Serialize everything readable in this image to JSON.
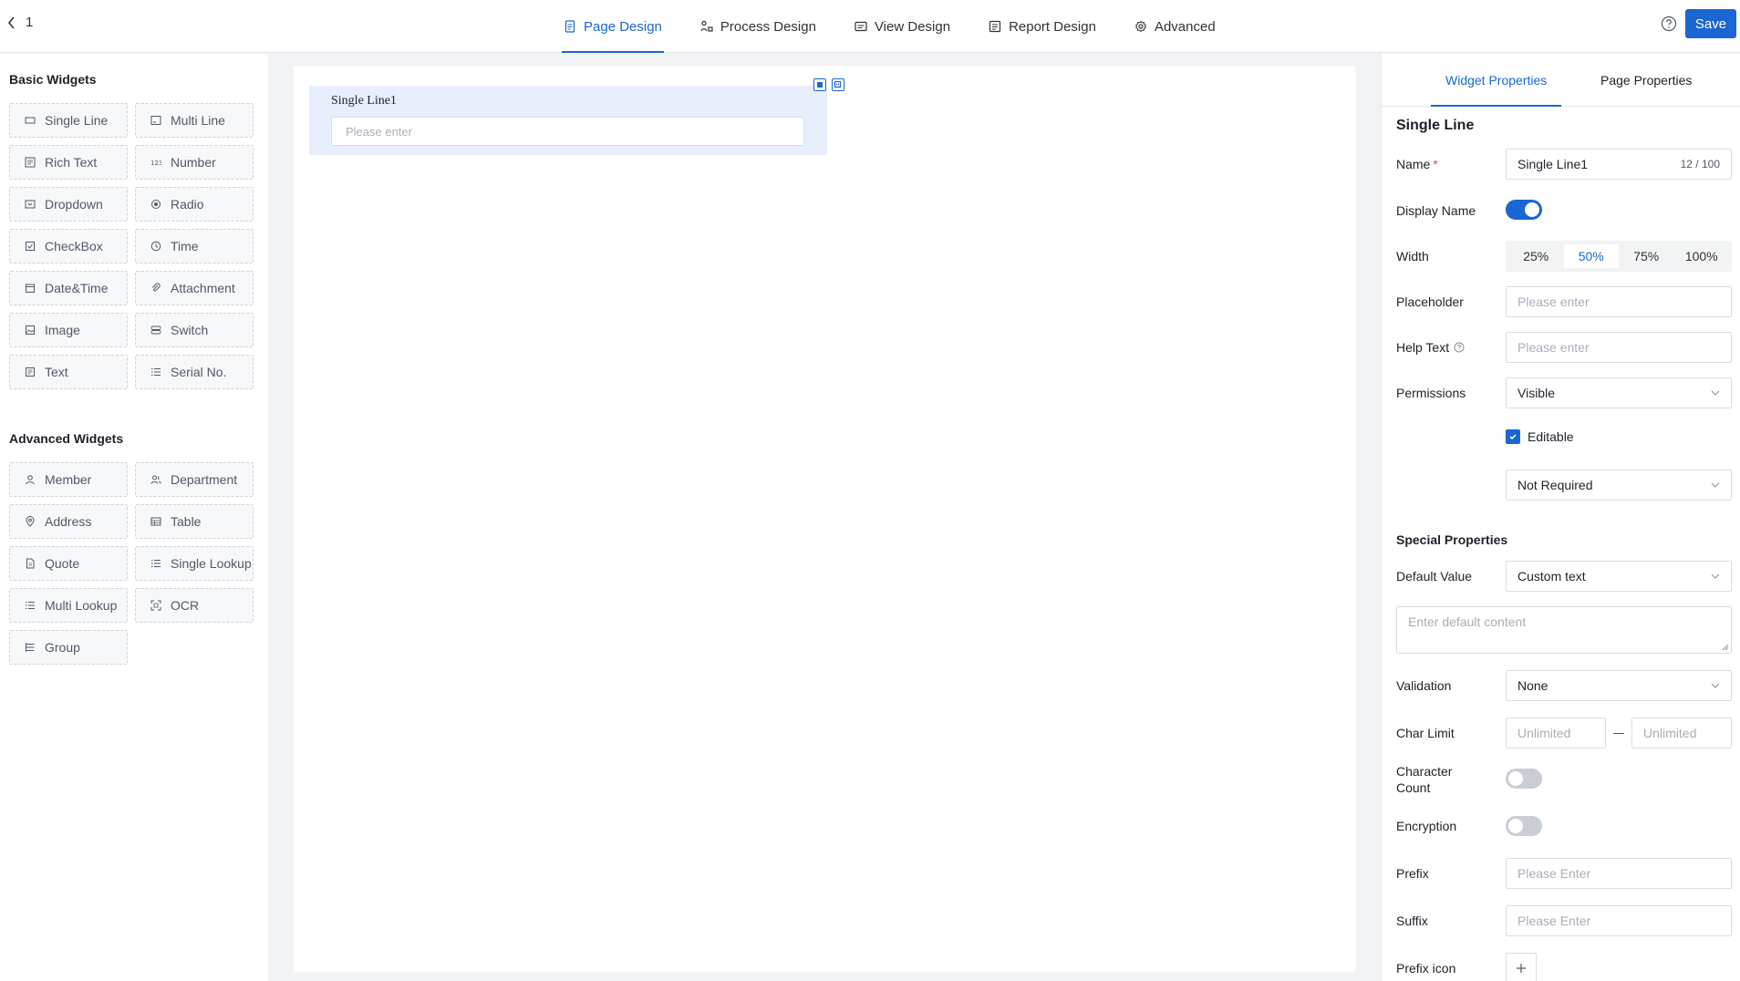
{
  "header": {
    "back_label": "1",
    "tabs": [
      {
        "label": "Page Design",
        "icon": "document-icon",
        "active": true
      },
      {
        "label": "Process Design",
        "icon": "flow-icon",
        "active": false
      },
      {
        "label": "View Design",
        "icon": "view-icon",
        "active": false
      },
      {
        "label": "Report Design",
        "icon": "report-icon",
        "active": false
      },
      {
        "label": "Advanced",
        "icon": "gear-icon",
        "active": false
      }
    ],
    "save_label": "Save"
  },
  "left_panel": {
    "basic_title": "Basic Widgets",
    "basic_widgets": [
      {
        "label": "Single Line",
        "icon": "single-line-icon"
      },
      {
        "label": "Multi Line",
        "icon": "multi-line-icon"
      },
      {
        "label": "Rich Text",
        "icon": "rich-text-icon"
      },
      {
        "label": "Number",
        "icon": "number-icon"
      },
      {
        "label": "Dropdown",
        "icon": "dropdown-icon"
      },
      {
        "label": "Radio",
        "icon": "radio-icon"
      },
      {
        "label": "CheckBox",
        "icon": "checkbox-icon"
      },
      {
        "label": "Time",
        "icon": "clock-icon"
      },
      {
        "label": "Date&Time",
        "icon": "calendar-icon"
      },
      {
        "label": "Attachment",
        "icon": "paperclip-icon"
      },
      {
        "label": "Image",
        "icon": "image-icon"
      },
      {
        "label": "Switch",
        "icon": "switch-icon"
      },
      {
        "label": "Text",
        "icon": "text-icon"
      },
      {
        "label": "Serial No.",
        "icon": "list-icon"
      }
    ],
    "advanced_title": "Advanced Widgets",
    "advanced_widgets": [
      {
        "label": "Member",
        "icon": "user-icon"
      },
      {
        "label": "Department",
        "icon": "department-icon"
      },
      {
        "label": "Address",
        "icon": "location-pin-icon"
      },
      {
        "label": "Table",
        "icon": "table-icon"
      },
      {
        "label": "Quote",
        "icon": "quote-icon"
      },
      {
        "label": "Single Lookup",
        "icon": "lookup-icon"
      },
      {
        "label": "Multi Lookup",
        "icon": "multi-lookup-icon"
      },
      {
        "label": "OCR",
        "icon": "scan-icon"
      },
      {
        "label": "Group",
        "icon": "group-icon"
      }
    ]
  },
  "canvas": {
    "field_label": "Single Line1",
    "field_placeholder": "Please enter"
  },
  "properties": {
    "tabs": [
      "Widget Properties",
      "Page Properties"
    ],
    "active_tab": "Widget Properties",
    "widget_type": "Single Line",
    "name_label": "Name",
    "name_required_mark": "*",
    "name_value": "Single Line1",
    "name_count": "12 / 100",
    "display_name_label": "Display Name",
    "display_name_on": true,
    "width_label": "Width",
    "width_options": [
      "25%",
      "50%",
      "75%",
      "100%"
    ],
    "width_selected": "50%",
    "placeholder_label": "Placeholder",
    "placeholder_ph": "Please enter",
    "help_text_label": "Help Text",
    "help_text_ph": "Please enter",
    "permissions_label": "Permissions",
    "permissions_value": "Visible",
    "editable_label": "Editable",
    "editable_checked": true,
    "required_value": "Not Required",
    "special_title": "Special Properties",
    "default_value_label": "Default Value",
    "default_value_value": "Custom text",
    "default_content_ph": "Enter default content",
    "validation_label": "Validation",
    "validation_value": "None",
    "char_limit_label": "Char Limit",
    "char_limit_min_ph": "Unlimited",
    "char_limit_max_ph": "Unlimited",
    "char_count_label": "Character Count",
    "char_count_on": false,
    "encryption_label": "Encryption",
    "encryption_on": false,
    "prefix_label": "Prefix",
    "prefix_ph": "Please Enter",
    "suffix_label": "Suffix",
    "suffix_ph": "Please Enter",
    "prefix_icon_label": "Prefix icon"
  },
  "colors": {
    "accent": "#1a66d2",
    "field_selected_bg": "#e8eefb",
    "required": "#e34d59"
  }
}
